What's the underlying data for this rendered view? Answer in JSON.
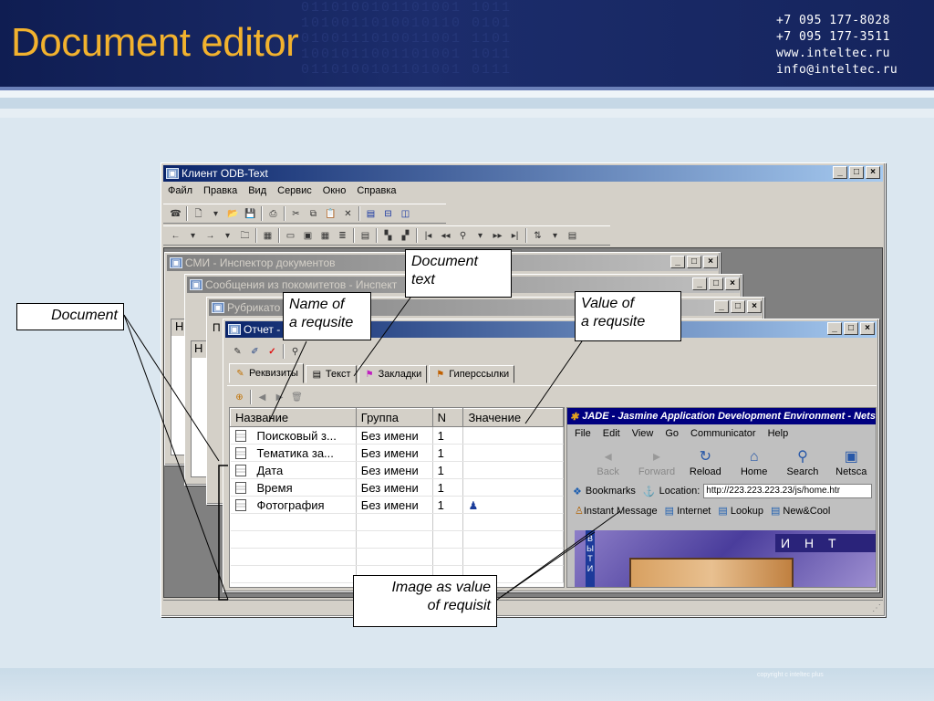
{
  "slide": {
    "title": "Document editor",
    "contacts": [
      "+7 095 177-8028",
      "+7 095 177-3511",
      "www.inteltec.ru",
      "info@inteltec.ru"
    ],
    "copyright": "copyright c inteltec plus"
  },
  "main_window": {
    "title": "Клиент ODB-Text",
    "menu": [
      "Файл",
      "Правка",
      "Вид",
      "Сервис",
      "Окно",
      "Справка"
    ]
  },
  "child_windows": {
    "inspector": "СМИ - Инспектор документов",
    "messages": "Сообщения из покомитетов - Инспект",
    "rubricator": "Рубрикато",
    "report": "Отчет - ... нтов",
    "stub_letters": [
      "Н",
      "Н",
      "П"
    ]
  },
  "report": {
    "tabs": [
      {
        "label": "Реквизиты",
        "icon": "requisites-icon"
      },
      {
        "label": "Текст",
        "icon": "text-icon"
      },
      {
        "label": "Закладки",
        "icon": "bookmarks-icon"
      },
      {
        "label": "Гиперссылки",
        "icon": "hyperlinks-icon"
      }
    ],
    "columns": [
      "Название",
      "Группа",
      "N",
      "Значение"
    ],
    "rows": [
      {
        "name": "Поисковый з...",
        "group": "Без имени",
        "n": "1",
        "value": ""
      },
      {
        "name": "Тематика за...",
        "group": "Без имени",
        "n": "1",
        "value": ""
      },
      {
        "name": "Дата",
        "group": "Без имени",
        "n": "1",
        "value": ""
      },
      {
        "name": "Время",
        "group": "Без имени",
        "n": "1",
        "value": ""
      },
      {
        "name": "Фотография",
        "group": "Без имени",
        "n": "1",
        "value": "image-icon"
      }
    ]
  },
  "browser": {
    "title": "JADE - Jasmine Application Development Environment - Netsc",
    "menu": [
      "File",
      "Edit",
      "View",
      "Go",
      "Communicator",
      "Help"
    ],
    "nav": [
      {
        "label": "Back",
        "icon": "back-arrow-icon",
        "enabled": false
      },
      {
        "label": "Forward",
        "icon": "forward-arrow-icon",
        "enabled": false
      },
      {
        "label": "Reload",
        "icon": "reload-icon",
        "enabled": true
      },
      {
        "label": "Home",
        "icon": "home-icon",
        "enabled": true
      },
      {
        "label": "Search",
        "icon": "search-icon",
        "enabled": true
      },
      {
        "label": "Netsca",
        "icon": "netscape-icon",
        "enabled": true
      }
    ],
    "bookmarks_label": "Bookmarks",
    "location_label": "Location:",
    "location_value": "http://223.223.223.23/js/home.htr",
    "links": [
      "Instant Message",
      "Internet",
      "Lookup",
      "New&Cool"
    ],
    "content_text": "И Н Т",
    "side_text": "ВЫТИ"
  },
  "callouts": {
    "document": "Document",
    "document_text": [
      "Document",
      "text"
    ],
    "name_of_requisite": [
      "Name of",
      "a requsite"
    ],
    "value_of_requisite": [
      "Value of",
      "a requsite"
    ],
    "image_as_value": [
      "Image as  value",
      "of requisit"
    ]
  }
}
